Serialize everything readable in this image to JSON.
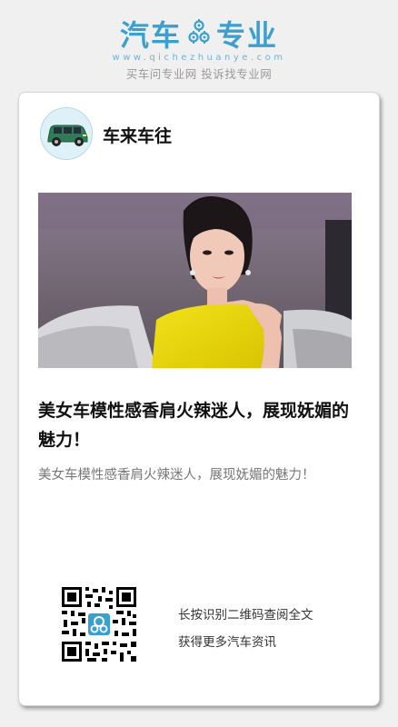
{
  "brand": {
    "name_left": "汽车",
    "name_right": "专业",
    "icon": "gear-icon",
    "url": "www.qichezhuanye.com",
    "slogan": "买车问专业网 投诉找专业网",
    "color": "#3aa0cf"
  },
  "card": {
    "author": {
      "name": "车来车往",
      "avatar_icon": "green-car-avatar"
    },
    "image": {
      "description_icon": "photo-model-yellow-dress"
    },
    "headline": "美女车模性感香肩火辣迷人，展现妩媚的魅力！",
    "summary": "美女车模性感香肩火辣迷人，展现妩媚的魅力！",
    "qr": {
      "icon": "qr-code-icon",
      "line1": "长按识别二维码查阅全文",
      "line2": "获得更多汽车资讯"
    }
  }
}
